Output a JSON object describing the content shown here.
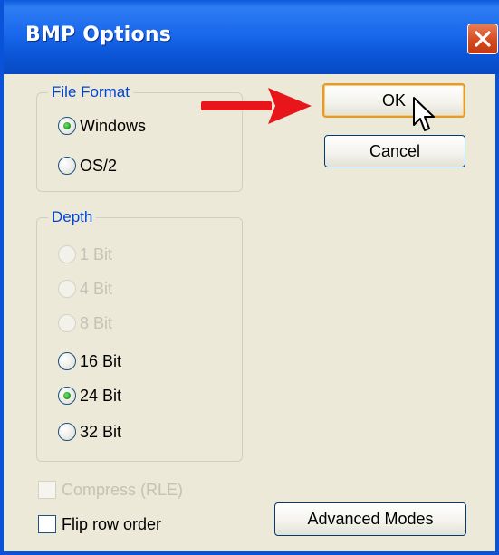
{
  "window": {
    "title": "BMP Options",
    "close_icon": "close-icon"
  },
  "file_format": {
    "legend": "File Format",
    "options": [
      {
        "label": "Windows",
        "selected": true
      },
      {
        "label": "OS/2",
        "selected": false
      }
    ]
  },
  "depth": {
    "legend": "Depth",
    "options": [
      {
        "label": "1 Bit",
        "selected": false,
        "enabled": false
      },
      {
        "label": "4 Bit",
        "selected": false,
        "enabled": false
      },
      {
        "label": "8 Bit",
        "selected": false,
        "enabled": false
      },
      {
        "label": "16 Bit",
        "selected": false,
        "enabled": true
      },
      {
        "label": "24 Bit",
        "selected": true,
        "enabled": true
      },
      {
        "label": "32 Bit",
        "selected": false,
        "enabled": true
      }
    ]
  },
  "options": {
    "compress_label": "Compress (RLE)",
    "compress_checked": false,
    "compress_enabled": false,
    "flip_label": "Flip row order",
    "flip_checked": false
  },
  "buttons": {
    "ok": "OK",
    "cancel": "Cancel",
    "advanced": "Advanced Modes"
  },
  "annotation": {
    "arrow_color": "#e8161b"
  }
}
